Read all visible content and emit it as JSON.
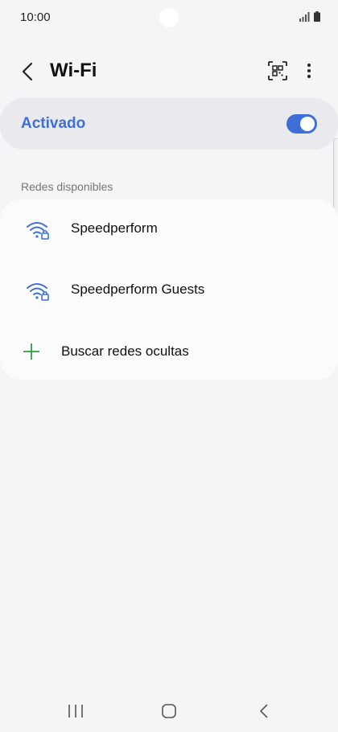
{
  "status_bar": {
    "time": "10:00",
    "icons": [
      "signal-icon",
      "battery-icon"
    ]
  },
  "app_bar": {
    "title": "Wi-Fi",
    "icons": [
      "back-arrow-icon",
      "qr-code-icon",
      "more-vert-icon"
    ]
  },
  "master_toggle": {
    "label": "Activado",
    "enabled": true
  },
  "available_networks": {
    "header": "Redes disponibles",
    "networks": [
      {
        "name": "Speedperform",
        "icon": "wifi-lock-icon"
      },
      {
        "name": "Speedperform Guests",
        "icon": "wifi-lock-icon"
      }
    ],
    "add_network": {
      "label": "Buscar redes ocultas",
      "icon": "plus-icon"
    }
  },
  "nav_bar": {
    "icons": [
      "recent-apps-icon",
      "home-icon",
      "back-icon"
    ]
  },
  "colors": {
    "accent": "#3e6fd6",
    "background": "#f5f5f7",
    "card": "#fbfbfd",
    "toggle_card": "#e9e9ee",
    "add_green": "#2e9e44"
  }
}
